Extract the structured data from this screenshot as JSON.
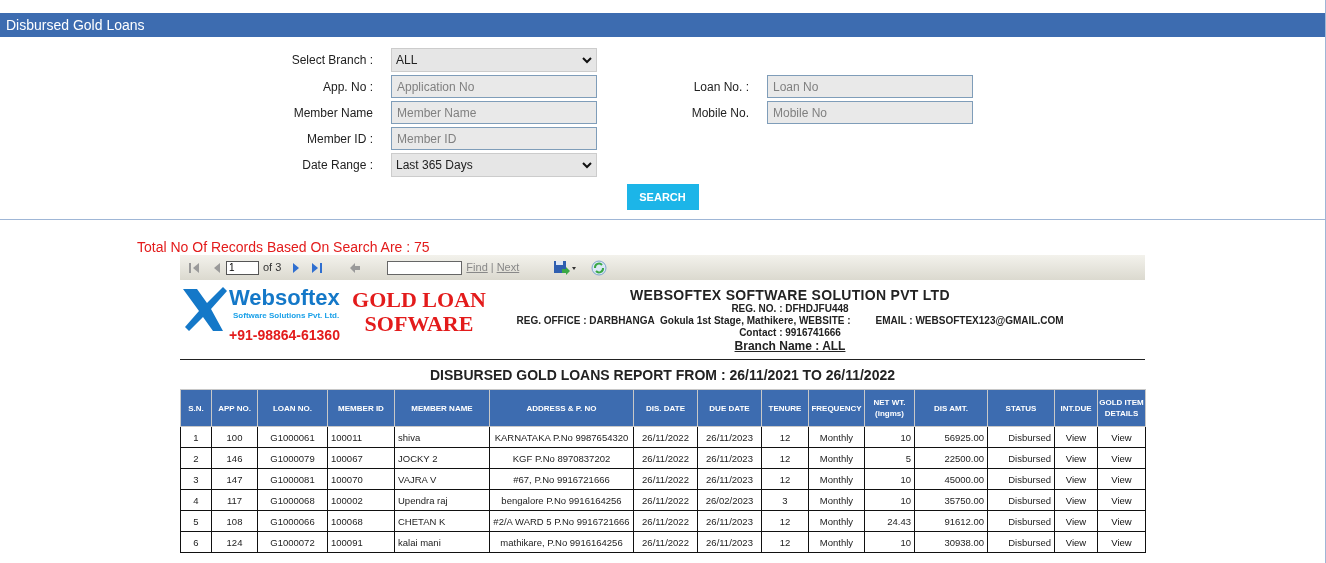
{
  "page_title": "Disbursed Gold Loans",
  "filter_rows": [
    [
      {
        "kind": "select",
        "label": "Select Branch :",
        "value": "ALL"
      }
    ],
    [
      {
        "kind": "text",
        "label": "App. No :",
        "placeholder": "Application No"
      },
      {
        "kind": "text",
        "label": "Loan No. :",
        "placeholder": "Loan No"
      }
    ],
    [
      {
        "kind": "text",
        "label": "Member Name",
        "placeholder": "Member Name"
      },
      {
        "kind": "text",
        "label": "Mobile No.",
        "placeholder": "Mobile No"
      }
    ],
    [
      {
        "kind": "text",
        "label": "Member ID :",
        "placeholder": "Member ID"
      }
    ],
    [
      {
        "kind": "select",
        "label": "Date Range :",
        "value": "Last 365 Days"
      }
    ]
  ],
  "search_button": "SEARCH",
  "records_summary": "Total No Of Records Based On Search Are : 75",
  "toolbar": {
    "buttons": [
      {
        "kind": "first",
        "disabled": true
      },
      {
        "kind": "prev",
        "disabled": true
      },
      {
        "kind": "page",
        "value": "1"
      },
      {
        "kind": "count",
        "text": "of 3"
      },
      {
        "kind": "next",
        "disabled": false
      },
      {
        "kind": "last",
        "disabled": false
      },
      {
        "kind": "back",
        "disabled": true
      },
      {
        "kind": "find"
      },
      {
        "kind": "link",
        "text": "Find"
      },
      {
        "kind": "sep",
        "text": "|"
      },
      {
        "kind": "link",
        "text": "Next"
      },
      {
        "kind": "save"
      },
      {
        "kind": "refresh"
      }
    ]
  },
  "report": {
    "logo": {
      "name": "Websoftex",
      "tagline": "Software Solutions Pvt. Ltd.",
      "phone": "+91-98864-61360"
    },
    "product": "GOLD LOAN SOFWARE",
    "company": {
      "name": "WEBSOFTEX SOFTWARE SOLUTION PVT LTD",
      "reg_no": "REG. NO. : DFHDJFU448",
      "address": "REG. OFFICE : DARBHANGA  Gokula 1st Stage, Mathikere, WEBSITE :         EMAIL : WEBSOFTEX123@GMAIL.COM    Contact : 9916741666",
      "branch": "Branch Name : ALL"
    },
    "title": "DISBURSED GOLD LOANS REPORT FROM : 26/11/2021 TO 26/11/2022",
    "table": {
      "columns": [
        "S.N.",
        "APP NO.",
        "LOAN NO.",
        "MEMBER ID",
        "MEMBER NAME",
        "ADDRESS & P. NO",
        "DIS. DATE",
        "DUE DATE",
        "TENURE",
        "FREQUENCY",
        "NET WT. (ingms)",
        "DIS AMT.",
        "STATUS",
        "INT.DUE",
        "GOLD ITEM DETAILS"
      ],
      "rows": [
        [
          "1",
          "100",
          "G1000061",
          "100011",
          "shiva",
          "KARNATAKA  P.No 9987654320",
          "26/11/2022",
          "26/11/2023",
          "12",
          "Monthly",
          "10",
          "56925.00",
          "Disbursed",
          "View",
          "View"
        ],
        [
          "2",
          "146",
          "G1000079",
          "100067",
          "JOCKY 2",
          "KGF  P.No 8970837202",
          "26/11/2022",
          "26/11/2023",
          "12",
          "Monthly",
          "5",
          "22500.00",
          "Disbursed",
          "View",
          "View"
        ],
        [
          "3",
          "147",
          "G1000081",
          "100070",
          "VAJRA V",
          "#67,  P.No 9916721666",
          "26/11/2022",
          "26/11/2023",
          "12",
          "Monthly",
          "10",
          "45000.00",
          "Disbursed",
          "View",
          "View"
        ],
        [
          "4",
          "117",
          "G1000068",
          "100002",
          "Upendra raj",
          "bengalore  P.No 9916164256",
          "26/11/2022",
          "26/02/2023",
          "3",
          "Monthly",
          "10",
          "35750.00",
          "Disbursed",
          "View",
          "View"
        ],
        [
          "5",
          "108",
          "G1000066",
          "100068",
          "CHETAN K",
          "#2/A WARD 5  P.No 9916721666",
          "26/11/2022",
          "26/11/2023",
          "12",
          "Monthly",
          "24.43",
          "91612.00",
          "Disbursed",
          "View",
          "View"
        ],
        [
          "6",
          "124",
          "G1000072",
          "100091",
          "kalai mani",
          "mathikare,  P.No 9916164256",
          "26/11/2022",
          "26/11/2023",
          "12",
          "Monthly",
          "10",
          "30938.00",
          "Disbursed",
          "View",
          "View"
        ]
      ]
    }
  }
}
